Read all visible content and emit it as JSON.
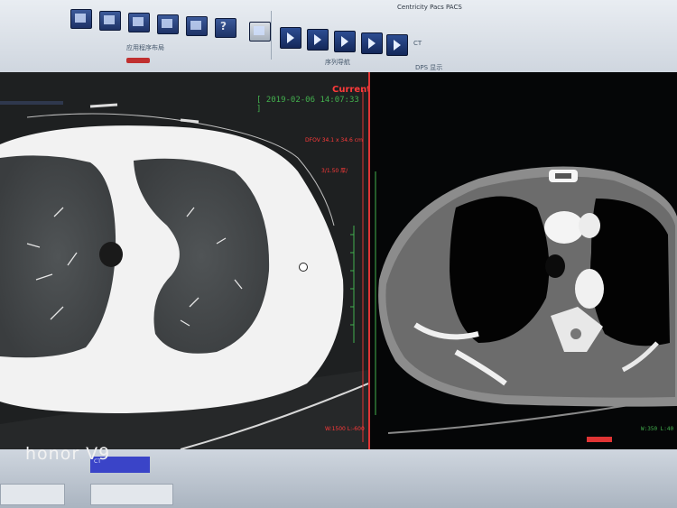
{
  "window": {
    "title": "Centricity Pacs PACS"
  },
  "menu": {
    "items": [
      "",
      "",
      ""
    ]
  },
  "ribbon": {
    "group_layout_label": "应用程序布局",
    "group_nav_label": "序列导航",
    "group_dps_label": "DPS 显示",
    "ct_label": "CT"
  },
  "viewport_left": {
    "header_label": "Current",
    "timestamp": "[ 2019-02-06 14:07:33 ]",
    "zoom": "DFOV 34.1 x 34.6 cm",
    "slice_info": "3/1.50 厚/",
    "window_info": "W:1500 L:-600"
  },
  "viewport_right": {
    "window_info": "W:350 L:40"
  },
  "status": {
    "chip_label": "CT"
  },
  "brand": {
    "text": "honor V9"
  },
  "colors": {
    "accent_red": "#e03434",
    "overlay_green": "#43b04e",
    "toolbar_blue": "#2d4d92"
  }
}
